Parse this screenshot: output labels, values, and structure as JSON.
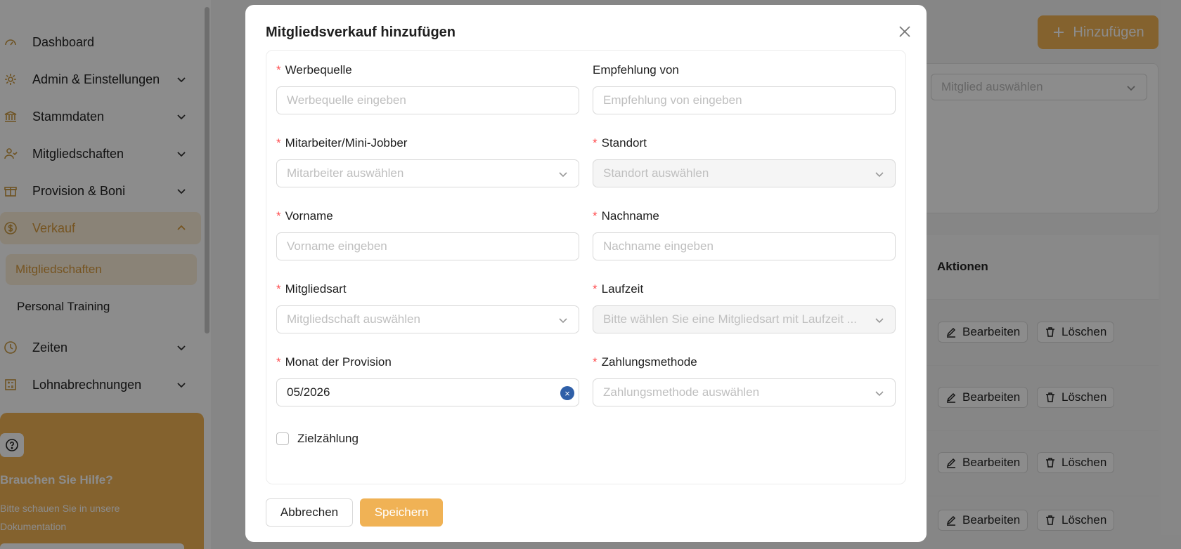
{
  "sidebar": {
    "items": [
      {
        "label": "Dashboard",
        "icon": "dashboard-icon"
      },
      {
        "label": "Admin & Einstellungen",
        "icon": "gear-icon"
      },
      {
        "label": "Stammdaten",
        "icon": "bank-icon"
      },
      {
        "label": "Mitgliedschaften",
        "icon": "users-icon"
      },
      {
        "label": "Provision & Boni",
        "icon": "gift-icon"
      },
      {
        "label": "Verkauf",
        "icon": "dollar-icon"
      },
      {
        "label": "Zeiten",
        "icon": "clock-icon"
      },
      {
        "label": "Lohnabrechnungen",
        "icon": "calculator-icon"
      }
    ],
    "sub_items": [
      "Mitgliedschaften",
      "Personal Training"
    ],
    "help": {
      "title": "Brauchen Sie Hilfe?",
      "text": "Bitte schauen Sie in unsere Dokumentation"
    }
  },
  "main": {
    "add_label": "Hinzufügen",
    "member_select_placeholder": "Mitglied auswählen",
    "actions_header": "Aktionen",
    "edit_label": "Bearbeiten",
    "delete_label": "Löschen"
  },
  "modal": {
    "title": "Mitgliedsverkauf hinzufügen",
    "fields": {
      "werbequelle": {
        "label": "Werbequelle",
        "placeholder": "Werbequelle eingeben"
      },
      "empfehlung": {
        "label": "Empfehlung von",
        "placeholder": "Empfehlung von eingeben"
      },
      "mitarbeiter": {
        "label": "Mitarbeiter/Mini-Jobber",
        "placeholder": "Mitarbeiter auswählen"
      },
      "standort": {
        "label": "Standort",
        "placeholder": "Standort auswählen"
      },
      "vorname": {
        "label": "Vorname",
        "placeholder": "Vorname eingeben"
      },
      "nachname": {
        "label": "Nachname",
        "placeholder": "Nachname eingeben"
      },
      "mitgliedsart": {
        "label": "Mitgliedsart",
        "placeholder": "Mitgliedschaft auswählen"
      },
      "laufzeit": {
        "label": "Laufzeit",
        "placeholder": "Bitte wählen Sie eine Mitgliedsart mit Laufzeit ..."
      },
      "monat": {
        "label": "Monat der Provision",
        "value": "05/2026"
      },
      "zahlungsmethode": {
        "label": "Zahlungsmethode",
        "placeholder": "Zahlungsmethode auswählen"
      }
    },
    "checkbox_label": "Zielzählung",
    "cancel_label": "Abbrechen",
    "save_label": "Speichern"
  }
}
